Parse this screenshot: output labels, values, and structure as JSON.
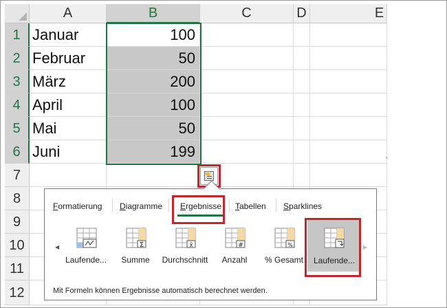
{
  "columns": [
    "A",
    "B",
    "C",
    "D",
    "E"
  ],
  "rows": [
    "1",
    "2",
    "3",
    "4",
    "5",
    "6",
    "7",
    "8",
    "9",
    "10",
    "11",
    "12"
  ],
  "cells": [
    {
      "month": "Januar",
      "value": "100"
    },
    {
      "month": "Februar",
      "value": "50"
    },
    {
      "month": "März",
      "value": "200"
    },
    {
      "month": "April",
      "value": "100"
    },
    {
      "month": "Mai",
      "value": "50"
    },
    {
      "month": "Juni",
      "value": "199"
    }
  ],
  "quick_analysis": {
    "tabs": [
      {
        "label": "Formatierung",
        "active": false
      },
      {
        "label": "Diagramme",
        "active": false
      },
      {
        "label": "Ergebnisse",
        "active": true
      },
      {
        "label": "Tabellen",
        "active": false
      },
      {
        "label": "Sparklines",
        "active": false
      }
    ],
    "options": [
      {
        "label": "Laufende...",
        "icon": "running-total-row-icon"
      },
      {
        "label": "Summe",
        "icon": "sum-icon"
      },
      {
        "label": "Durchschnitt",
        "icon": "average-icon"
      },
      {
        "label": "Anzahl",
        "icon": "count-icon"
      },
      {
        "label": "% Gesamt",
        "icon": "percent-total-icon"
      },
      {
        "label": "Laufende...",
        "icon": "running-total-column-icon",
        "selected": true
      }
    ],
    "hint": "Mit Formeln können Ergebnisse automatisch berechnet werden."
  },
  "colors": {
    "accent": "#217346",
    "highlight_red": "#c0282f",
    "selection_fill": "#c8c8c8"
  }
}
